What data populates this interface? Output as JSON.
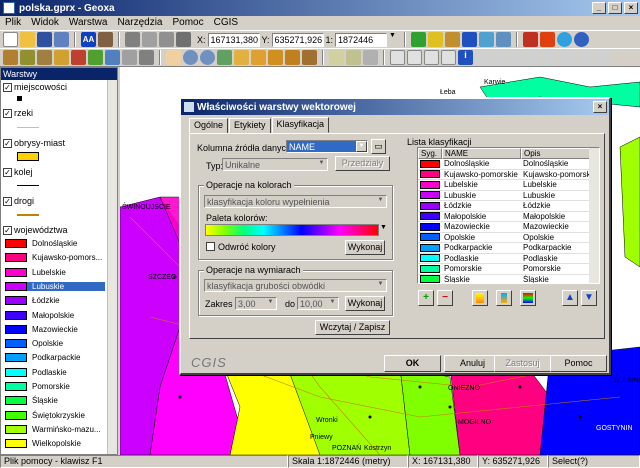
{
  "window": {
    "title": "polska.gprx - Geoxa",
    "controls": [
      "_",
      "□",
      "×"
    ]
  },
  "menu": [
    "Plik",
    "Widok",
    "Warstwa",
    "Narzędzia",
    "Pomoc",
    "CGIS"
  ],
  "toolbar": {
    "x_label": "X:",
    "x_value": "167131,380",
    "y_label": "Y:",
    "y_value": "635271,926",
    "scale_label": "1:",
    "scale_value": "1872446"
  },
  "layers": {
    "title": "Warstwy",
    "items": [
      "miejscowości",
      "rzeki",
      "obrysy-miast",
      "kolej",
      "drogi",
      "województwa"
    ],
    "voivodeships": [
      {
        "name": "Dolnośląskie",
        "color": "#ff0000"
      },
      {
        "name": "Kujawsko-pomors...",
        "color": "#ff0080"
      },
      {
        "name": "Lubelskie",
        "color": "#ff00cc"
      },
      {
        "name": "Lubuskie",
        "color": "#cc00ff"
      },
      {
        "name": "Łódzkie",
        "color": "#9900ff"
      },
      {
        "name": "Małopolskie",
        "color": "#4000ff"
      },
      {
        "name": "Mazowieckie",
        "color": "#0000ff"
      },
      {
        "name": "Opolskie",
        "color": "#0060ff"
      },
      {
        "name": "Podkarpackie",
        "color": "#00a0ff"
      },
      {
        "name": "Podlaskie",
        "color": "#00ffff"
      },
      {
        "name": "Pomorskie",
        "color": "#00ffa0"
      },
      {
        "name": "Śląskie",
        "color": "#00ff40"
      },
      {
        "name": "Świętokrzyskie",
        "color": "#40ff00"
      },
      {
        "name": "Warmińsko-mazu...",
        "color": "#a0ff00"
      },
      {
        "name": "Wielkopolskie",
        "color": "#ffff00"
      }
    ]
  },
  "map": {
    "labels": [
      "Karwie",
      "Łeba",
      "ŚWINOUJŚCIE",
      "SZCZEC",
      "GNIEZNO",
      "MOGILNO",
      "Wronki",
      "Pniewy",
      "POZNAŃ",
      "Kostrzyn",
      "GOSTYNIN",
      "ŚLESIN"
    ]
  },
  "dialog": {
    "title": "Właściwości warstwy wektorowej",
    "tabs": [
      "Ogólne",
      "Etykiety",
      "Klasyfikacja"
    ],
    "source_label": "Kolumna źródła danych:",
    "source_value": "NAME",
    "type_label": "Typ:",
    "type_value": "Unikalne",
    "intervals_btn": "Przedziały",
    "colors_group": "Operacje na kolorach",
    "colors_combo": "klasyfikacja koloru wypełnienia",
    "palette_label": "Paleta kolorów:",
    "reverse_label": "Odwróć kolory",
    "execute_btn": "Wykonaj",
    "dims_group": "Operacje na wymiarach",
    "dims_combo": "klasyfikacja grubości obwódki",
    "range_from_label": "Zakres od",
    "range_from": "3,00",
    "range_to_label": "do",
    "range_to": "10,00",
    "load_save_btn": "Wczytaj / Zapisz",
    "list_title": "Lista klasyfikacji",
    "col_sym": "Syg.",
    "col_name": "NAME",
    "col_desc": "Opis",
    "rows": [
      {
        "name": "Dolnośląskie",
        "desc": "Dolnośląskie",
        "color": "#ff0000"
      },
      {
        "name": "Kujawsko-pomorskie",
        "desc": "Kujawsko-pomorskie",
        "color": "#ff0080"
      },
      {
        "name": "Lubelskie",
        "desc": "Lubelskie",
        "color": "#ff00cc"
      },
      {
        "name": "Lubuskie",
        "desc": "Lubuskie",
        "color": "#cc00ff"
      },
      {
        "name": "Łódzkie",
        "desc": "Łódzkie",
        "color": "#9900ff"
      },
      {
        "name": "Małopolskie",
        "desc": "Małopolskie",
        "color": "#4000ff"
      },
      {
        "name": "Mazowieckie",
        "desc": "Mazowieckie",
        "color": "#0000ff"
      },
      {
        "name": "Opolskie",
        "desc": "Opolskie",
        "color": "#0060ff"
      },
      {
        "name": "Podkarpackie",
        "desc": "Podkarpackie",
        "color": "#00a0ff"
      },
      {
        "name": "Podlaskie",
        "desc": "Podlaskie",
        "color": "#00ffff"
      },
      {
        "name": "Pomorskie",
        "desc": "Pomorskie",
        "color": "#00ffa0"
      },
      {
        "name": "Śląskie",
        "desc": "Śląskie",
        "color": "#00ff40"
      }
    ],
    "add_icon": "+",
    "remove_icon": "−",
    "logo": "CGIS",
    "ok_btn": "OK",
    "cancel_btn": "Anuluj",
    "apply_btn": "Zastosuj",
    "help_btn": "Pomoc"
  },
  "status": {
    "help": "Plik pomocy - klawisz F1",
    "scale": "Skala 1:1872446 (metry)",
    "x": "X: 167131,380",
    "y": "Y: 635271,926",
    "select": "Select(?)"
  }
}
